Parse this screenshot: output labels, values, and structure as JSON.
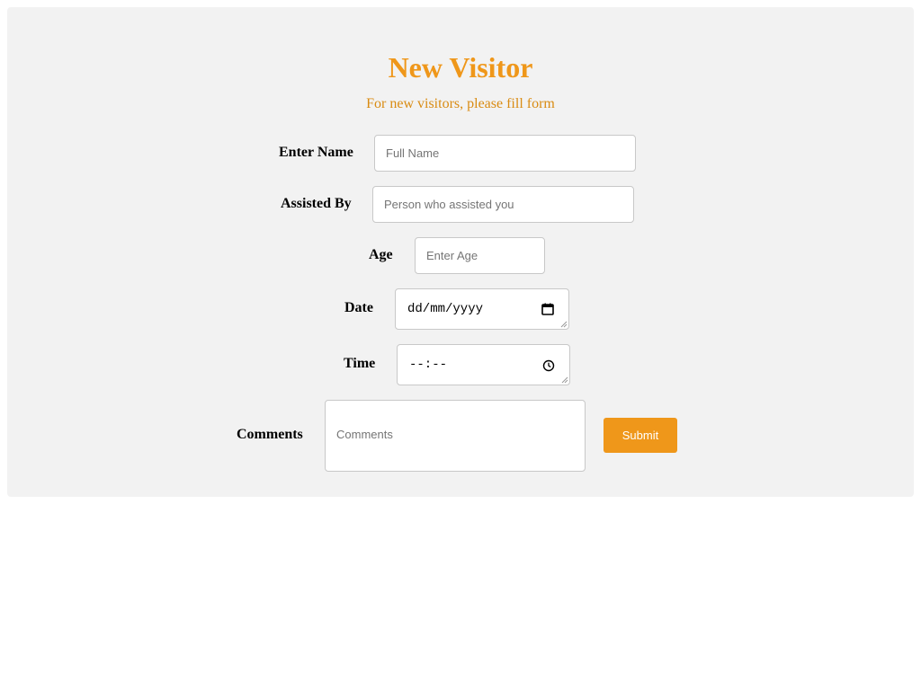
{
  "colors": {
    "accent": "#ef971a",
    "subtitle": "#d98b12",
    "card_background": "#f2f2f2",
    "border": "#c8c8c8"
  },
  "form": {
    "title": "New Visitor",
    "subtitle": "For new visitors, please fill form",
    "name": {
      "label": "Enter Name",
      "placeholder": "Full Name"
    },
    "assisted_by": {
      "label": "Assisted By",
      "placeholder": "Person who assisted you"
    },
    "age": {
      "label": "Age",
      "placeholder": "Enter Age"
    },
    "date": {
      "label": "Date",
      "value": "dd/mm/yyyy",
      "icon": "calendar-icon"
    },
    "time": {
      "label": "Time",
      "value": "--:--",
      "icon": "clock-icon"
    },
    "comments": {
      "label": "Comments",
      "placeholder": "Comments"
    },
    "submit_label": "Submit"
  }
}
